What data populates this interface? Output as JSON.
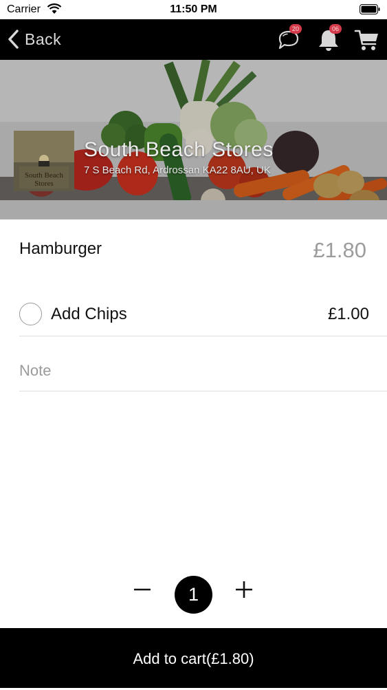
{
  "status_bar": {
    "carrier": "Carrier",
    "time": "11:50 PM"
  },
  "nav": {
    "back_label": "Back",
    "chat_badge": "20",
    "notification_badge": "06"
  },
  "store": {
    "name": "South Beach Stores",
    "address": "7 S Beach Rd, Ardrossan KA22 8AU, UK",
    "logo_text_line1": "South Beach",
    "logo_text_line2": "Stores"
  },
  "product": {
    "name": "Hamburger",
    "price": "£1.80"
  },
  "options": [
    {
      "label": "Add Chips",
      "price": "£1.00",
      "selected": false
    }
  ],
  "note": {
    "placeholder": "Note",
    "value": ""
  },
  "quantity": {
    "value": "1"
  },
  "cart_button": {
    "label": "Add to cart(£1.80)"
  },
  "colors": {
    "nav_background": "#000000",
    "badge": "#d43a4a",
    "price_muted": "#9c9c9c"
  }
}
